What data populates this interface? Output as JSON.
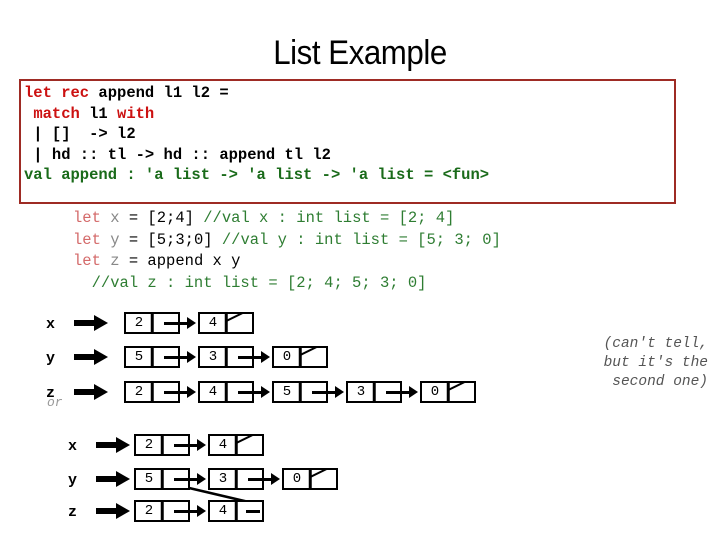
{
  "slide": {
    "title": "List Example"
  },
  "code_box": {
    "border_color": "#9e2b24",
    "keyword_color": "#cc1111",
    "output_color": "#1a6b1a",
    "lines": [
      [
        {
          "t": "let rec ",
          "c": "kw-red"
        },
        {
          "t": "append l1 l2 =",
          "c": "code-blk"
        }
      ],
      [
        {
          "t": " ",
          "c": "code-blk"
        },
        {
          "t": "match ",
          "c": "kw-red"
        },
        {
          "t": "l1 ",
          "c": "code-blk"
        },
        {
          "t": "with",
          "c": "kw-red"
        }
      ],
      [
        {
          "t": " | []  -> l2",
          "c": "code-blk"
        }
      ],
      [
        {
          "t": " | hd :: tl -> hd :: append tl l2",
          "c": "code-blk"
        }
      ],
      [
        {
          "t": "val append : 'a list -> 'a list -> 'a list = <fun>",
          "c": "kw-green"
        }
      ]
    ]
  },
  "example_code": {
    "lines": [
      [
        {
          "t": "let ",
          "c": "ex-let"
        },
        {
          "t": "x ",
          "c": "ex-var"
        },
        {
          "t": "= [2;4] ",
          "c": "ex-body"
        },
        {
          "t": "//val x : int list = [2; 4]",
          "c": "ex-cmt"
        }
      ],
      [
        {
          "t": "let ",
          "c": "ex-let"
        },
        {
          "t": "y ",
          "c": "ex-var"
        },
        {
          "t": "= [5;3;0] ",
          "c": "ex-body"
        },
        {
          "t": "//val y : int list = [5; 3; 0]",
          "c": "ex-cmt"
        }
      ],
      [
        {
          "t": "let ",
          "c": "ex-let"
        },
        {
          "t": "z ",
          "c": "ex-var"
        },
        {
          "t": "= append x y",
          "c": "ex-body"
        }
      ],
      [
        {
          "t": "  ",
          "c": "ex-body"
        },
        {
          "t": "//val z : int list = [2; 4; 5; 3; 0]",
          "c": "ex-cmt"
        }
      ]
    ]
  },
  "diagram": {
    "or_label": "or",
    "note": "(can't tell,\nbut it's the\nsecond one)",
    "top_rows": [
      {
        "label": "x",
        "values": [
          "2",
          "4"
        ],
        "terminated": true
      },
      {
        "label": "y",
        "values": [
          "5",
          "3",
          "0"
        ],
        "terminated": true
      },
      {
        "label": "z",
        "values": [
          "2",
          "4",
          "5",
          "3",
          "0"
        ],
        "terminated": true
      }
    ],
    "bottom_rows": [
      {
        "label": "x",
        "values": [
          "2",
          "4"
        ],
        "terminated": true
      },
      {
        "label": "y",
        "values": [
          "5",
          "3",
          "0"
        ],
        "terminated": true
      },
      {
        "label": "z",
        "values": [
          "2",
          "4"
        ],
        "terminated": false,
        "shares_tail_with": "y"
      }
    ]
  }
}
